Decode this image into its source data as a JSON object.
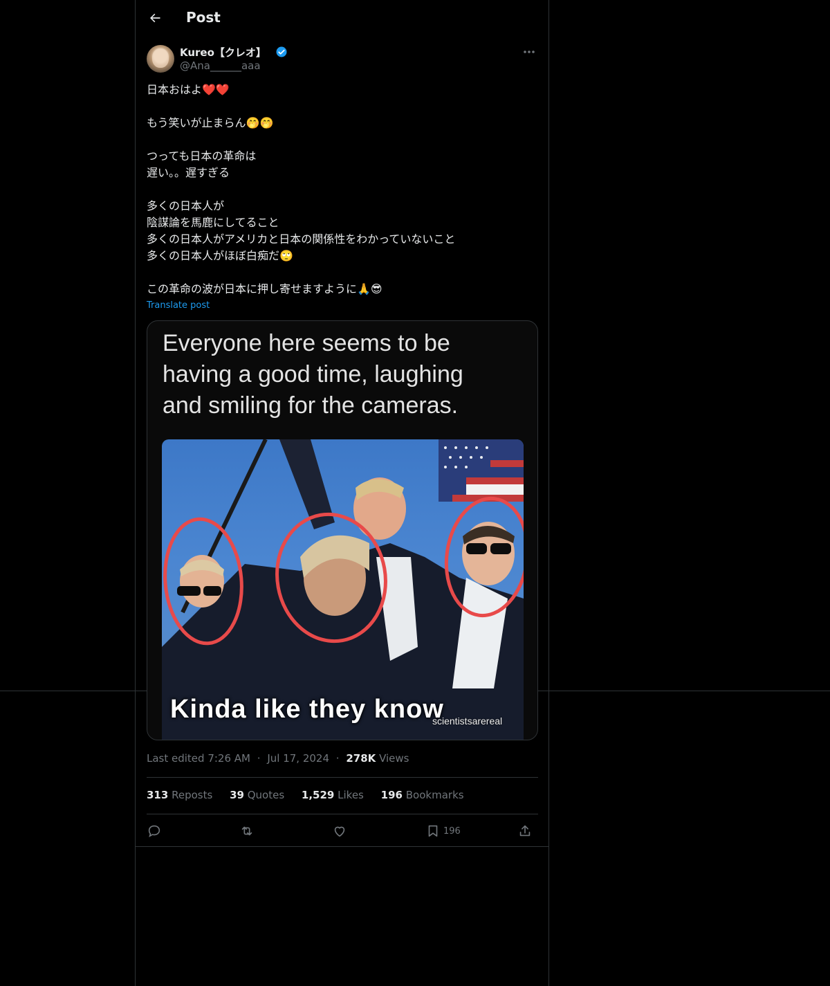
{
  "header": {
    "title": "Post",
    "back_icon": "arrow-left-icon"
  },
  "author": {
    "display_name": "Kureo【クレオ】",
    "handle": "@Ana______aaa",
    "verified": true
  },
  "post": {
    "lines": [
      "日本おはよ❤️❤️",
      "",
      "もう笑いが止まらん🤭🤭",
      "",
      "つっても日本の革命は",
      "遅い。。遅すぎる",
      "",
      "多くの日本人が",
      "陰謀論を馬鹿にしてること",
      "多くの日本人がアメリカと日本の関係性をわかっていないこと",
      "多くの日本人がほぼ白痴だ🙄",
      "",
      "この革命の波が日本に押し寄せますように🙏😎"
    ],
    "translate_label": "Translate post"
  },
  "media": {
    "top_caption": [
      "Everyone here seems to be",
      "having a good time, laughing",
      "and smiling for the cameras."
    ],
    "bottom_caption": "Kinda like they know",
    "watermark": "scientistsarereal"
  },
  "meta": {
    "edited": "Last edited 7:26 AM",
    "date": "Jul 17, 2024",
    "separator": "·",
    "views_count": "278K",
    "views_label": "Views"
  },
  "stats": {
    "reposts_count": "313",
    "reposts_label": "Reposts",
    "quotes_count": "39",
    "quotes_label": "Quotes",
    "likes_count": "1,529",
    "likes_label": "Likes",
    "bookmarks_count": "196",
    "bookmarks_label": "Bookmarks"
  },
  "actions": {
    "reply_icon": "reply-icon",
    "repost_icon": "repost-icon",
    "like_icon": "heart-icon",
    "bookmark_icon": "bookmark-icon",
    "bookmark_count": "196",
    "share_icon": "share-icon"
  },
  "colors": {
    "background": "#000000",
    "text": "#e7e9ea",
    "muted": "#71767b",
    "accent": "#1d9bf0",
    "border": "#2f3336"
  }
}
